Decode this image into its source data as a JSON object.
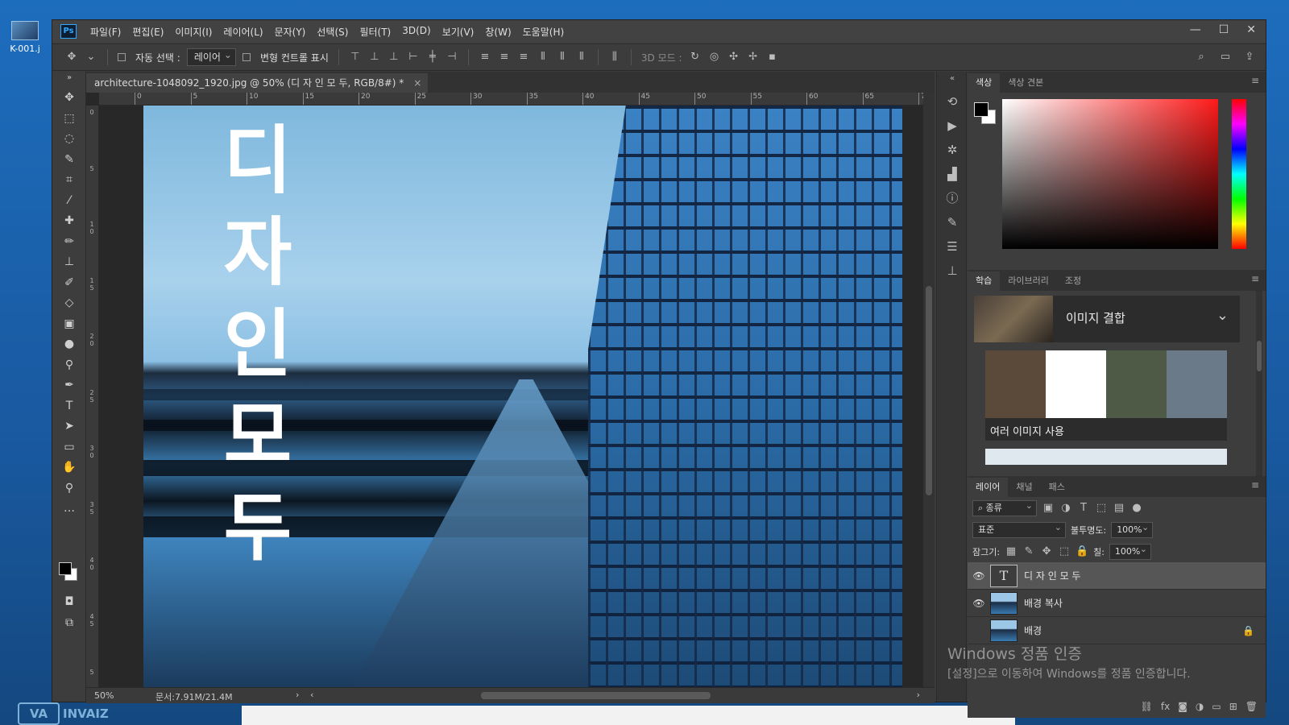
{
  "desktop": {
    "icon_label": "K-001.j",
    "watermark_box": "VA",
    "watermark_text": "INVAIZ"
  },
  "app": {
    "logo": "Ps",
    "menu": [
      "파일(F)",
      "편집(E)",
      "이미지(I)",
      "레이어(L)",
      "문자(Y)",
      "선택(S)",
      "필터(T)",
      "3D(D)",
      "보기(V)",
      "창(W)",
      "도움말(H)"
    ],
    "window_buttons": [
      "—",
      "☐",
      "✕"
    ]
  },
  "options": {
    "auto_select_label": "자동 선택 :",
    "auto_select_value": "레이어",
    "transform_controls_label": "변형 컨트롤 표시",
    "mode_3d_label": "3D 모드 :"
  },
  "document": {
    "tab_title": "architecture-1048092_1920.jpg @ 50% (디 자 인 모 두, RGB/8#) *",
    "ruler_h": [
      "0",
      "5",
      "10",
      "15",
      "20",
      "25",
      "30",
      "35",
      "40",
      "45",
      "50",
      "55",
      "60",
      "65",
      "7"
    ],
    "ruler_v": [
      "0",
      "5",
      "1\n0",
      "1\n5",
      "2\n0",
      "2\n5",
      "3\n0",
      "3\n5",
      "4\n0",
      "4\n5",
      "5"
    ],
    "vertical_text": [
      "디",
      "자",
      "인",
      "모",
      "두"
    ],
    "zoom": "50%",
    "doc_info": "문서:7.91M/21.4M"
  },
  "panels": {
    "color_tabs": [
      "색상",
      "색상 견본"
    ],
    "learn_tabs": [
      "학습",
      "라이브러리",
      "조정"
    ],
    "learn_card_title": "이미지 결합",
    "learn_sub_label": "여러 이미지 사용",
    "layers_tabs": [
      "레이어",
      "채널",
      "패스"
    ],
    "filter_label": "종류",
    "blend_mode": "표준",
    "opacity_label": "불투명도:",
    "opacity_value": "100%",
    "lock_label": "잠그기:",
    "fill_label": "칠:",
    "fill_value": "100%",
    "layers": [
      {
        "name": "디 자 인 모 두",
        "type": "text",
        "visible": true,
        "selected": true
      },
      {
        "name": "배경 복사",
        "type": "image",
        "visible": true,
        "selected": false
      },
      {
        "name": "배경",
        "type": "image",
        "visible": false,
        "selected": false,
        "locked": true
      }
    ]
  },
  "activation": {
    "title": "Windows 정품 인증",
    "subtitle": "[설정]으로 이동하여 Windows를 정품 인증합니다."
  },
  "colors": {
    "foreground": "#000000",
    "background": "#ffffff",
    "ps_accent": "#31a8ff"
  }
}
